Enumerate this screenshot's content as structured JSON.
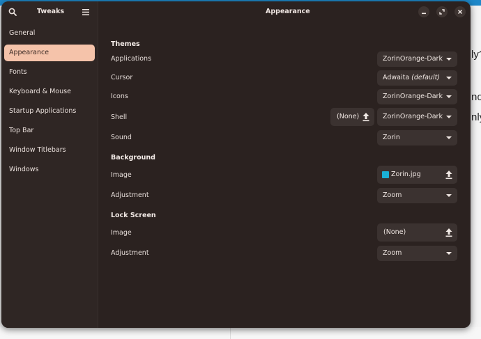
{
  "background": {
    "fragments": [
      "ly?",
      "no",
      "nly"
    ]
  },
  "sidebar": {
    "title": "Tweaks",
    "items": [
      {
        "label": "General",
        "active": false
      },
      {
        "label": "Appearance",
        "active": true
      },
      {
        "label": "Fonts",
        "active": false
      },
      {
        "label": "Keyboard & Mouse",
        "active": false
      },
      {
        "label": "Startup Applications",
        "active": false
      },
      {
        "label": "Top Bar",
        "active": false
      },
      {
        "label": "Window Titlebars",
        "active": false
      },
      {
        "label": "Windows",
        "active": false
      }
    ]
  },
  "header": {
    "title": "Appearance"
  },
  "themes": {
    "title": "Themes",
    "applications": {
      "label": "Applications",
      "value": "ZorinOrange-Dark"
    },
    "cursor": {
      "label": "Cursor",
      "value": "Adwaita",
      "suffix": "(default)"
    },
    "icons": {
      "label": "Icons",
      "value": "ZorinOrange-Dark"
    },
    "shell": {
      "label": "Shell",
      "file": "(None)",
      "value": "ZorinOrange-Dark"
    },
    "sound": {
      "label": "Sound",
      "value": "Zorin"
    }
  },
  "background_section": {
    "title": "Background",
    "image": {
      "label": "Image",
      "file": "Zorin.jpg"
    },
    "adjustment": {
      "label": "Adjustment",
      "value": "Zoom"
    }
  },
  "lock_screen": {
    "title": "Lock Screen",
    "image": {
      "label": "Image",
      "file": "(None)"
    },
    "adjustment": {
      "label": "Adjustment",
      "value": "Zoom"
    }
  },
  "colors": {
    "accent": "#f5c3aa",
    "window_bg": "#2b2220",
    "sidebar_bg": "#2f2624"
  }
}
